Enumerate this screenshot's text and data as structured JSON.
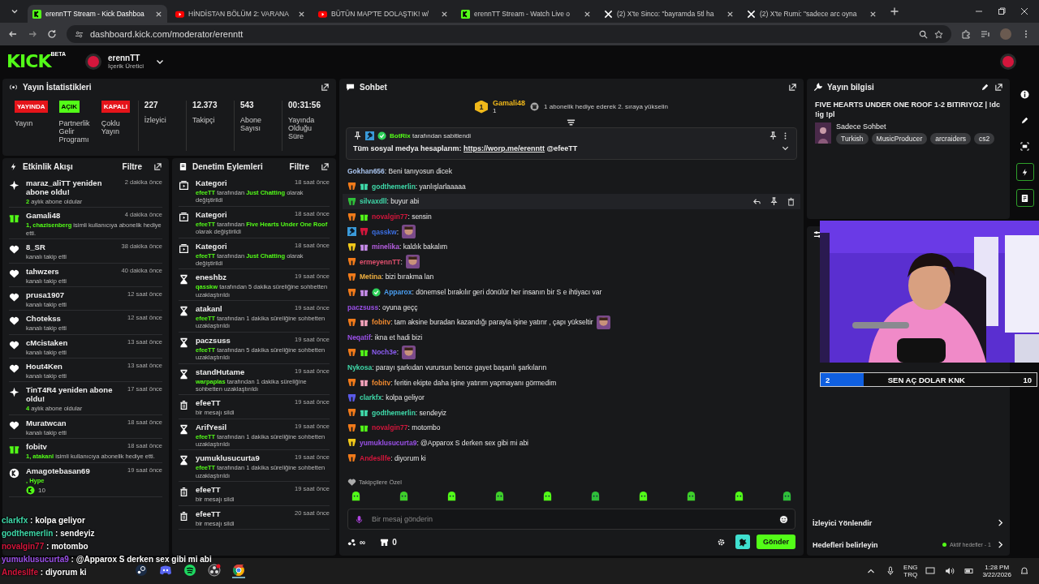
{
  "browser": {
    "tabs": [
      {
        "kind": "kick",
        "title": "erennTT Stream - Kick Dashboa",
        "selected": true
      },
      {
        "kind": "youtube",
        "title": "HİNDİSTAN BÖLÜM 2: VARANA",
        "selected": false
      },
      {
        "kind": "youtube",
        "title": "BÜTÜN MAP'TE DOLAŞTIK! w/",
        "selected": false
      },
      {
        "kind": "kick",
        "title": "erennTT Stream - Watch Live o",
        "selected": false
      },
      {
        "kind": "x",
        "title": "(2) X'te Sinco: \"bayramda 5tl ha",
        "selected": false
      },
      {
        "kind": "x",
        "title": "(2) X'te Rumi: \"sadece arc oyna",
        "selected": false
      }
    ],
    "url": "dashboard.kick.com/moderator/erenntt"
  },
  "header": {
    "logo": "KICK",
    "logo_tag": "BETA",
    "channel": "erennTT",
    "role": "İçerik Üretici"
  },
  "stats": {
    "title": "Yayın İstatistikleri",
    "items": [
      {
        "kind": "badge",
        "badge": "YAYINDA",
        "color": "#e5141a",
        "caption": "Yayın"
      },
      {
        "kind": "badge",
        "badge": "AÇIK",
        "color": "#53fc18",
        "caption": "Partnerlik Gelir Programı"
      },
      {
        "kind": "badge",
        "badge": "KAPALI",
        "color": "#e5141a",
        "caption": "Çoklu Yayın"
      },
      {
        "kind": "value",
        "value": "227",
        "caption": "İzleyici"
      },
      {
        "kind": "value",
        "value": "12.373",
        "caption": "Takipçi"
      },
      {
        "kind": "value",
        "value": "543",
        "caption": "Abone Sayısı"
      },
      {
        "kind": "value",
        "value": "00:31:56",
        "caption": "Yayında Olduğu Süre"
      }
    ]
  },
  "activity": {
    "title": "Etkinlik Akışı",
    "filter": "Filtre",
    "items": [
      {
        "kind": "resub",
        "title": "maraz_aliTT yeniden abone oldu!",
        "time": "2 dakika önce",
        "detail": [
          {
            "text": "2",
            "accent": true
          },
          {
            "text": " aylık abone oldular",
            "accent": false
          }
        ]
      },
      {
        "kind": "gift",
        "title": "Gamali48",
        "time": "4 dakika önce",
        "detail": [
          {
            "text": "1, chazisenberg",
            "accent": true
          },
          {
            "text": " isimli kullanıcıya abonelik hediye etti.",
            "accent": false
          }
        ]
      },
      {
        "kind": "follow",
        "title": "8_SR",
        "time": "38 dakika önce",
        "detail": [
          {
            "text": "kanalı takip etti",
            "accent": false
          }
        ]
      },
      {
        "kind": "follow",
        "title": "tahwzers",
        "time": "40 dakika önce",
        "detail": [
          {
            "text": "kanalı takip etti",
            "accent": false
          }
        ]
      },
      {
        "kind": "follow",
        "title": "prusa1907",
        "time": "12 saat önce",
        "detail": [
          {
            "text": "kanalı takip etti",
            "accent": false
          }
        ]
      },
      {
        "kind": "follow",
        "title": "Chotekss",
        "time": "12 saat önce",
        "detail": [
          {
            "text": "kanalı takip etti",
            "accent": false
          }
        ]
      },
      {
        "kind": "follow",
        "title": "cMcistaken",
        "time": "13 saat önce",
        "detail": [
          {
            "text": "kanalı takip etti",
            "accent": false
          }
        ]
      },
      {
        "kind": "follow",
        "title": "Hout4Ken",
        "time": "13 saat önce",
        "detail": [
          {
            "text": "kanalı takip etti",
            "accent": false
          }
        ]
      },
      {
        "kind": "resub",
        "title": "TinT4R4 yeniden abone oldu!",
        "time": "17 saat önce",
        "detail": [
          {
            "text": "4",
            "accent": true
          },
          {
            "text": " aylık abone oldular",
            "accent": false
          }
        ]
      },
      {
        "kind": "follow",
        "title": "Muratwcan",
        "time": "18 saat önce",
        "detail": [
          {
            "text": "kanalı takip etti",
            "accent": false
          }
        ]
      },
      {
        "kind": "gift",
        "title": "fobitv",
        "time": "18 saat önce",
        "detail": [
          {
            "text": "1, atakanl",
            "accent": true
          },
          {
            "text": " isimli kullanıcıya abonelik hediye etti.",
            "accent": false
          }
        ]
      },
      {
        "kind": "kicks",
        "title": "Amagotebasan69",
        "time": "19 saat önce",
        "detail": [
          {
            "text": ", Hype",
            "accent": true
          }
        ],
        "amount": "10"
      }
    ]
  },
  "moderation": {
    "title": "Denetim Eylemleri",
    "filter": "Filtre",
    "items": [
      {
        "kind": "category",
        "title": "Kategori",
        "time": "18 saat önce",
        "detail": [
          {
            "text": "efeeTT",
            "accent": true
          },
          {
            "text": " tarafından ",
            "accent": false
          },
          {
            "text": "Just Chatting",
            "accent": true
          },
          {
            "text": " olarak değiştirildi",
            "accent": false
          }
        ]
      },
      {
        "kind": "category",
        "title": "Kategori",
        "time": "18 saat önce",
        "detail": [
          {
            "text": "efeeTT",
            "accent": true
          },
          {
            "text": " tarafından ",
            "accent": false
          },
          {
            "text": "Five Hearts Under One Roof",
            "accent": true
          },
          {
            "text": " olarak değiştirildi",
            "accent": false
          }
        ]
      },
      {
        "kind": "category",
        "title": "Kategori",
        "time": "18 saat önce",
        "detail": [
          {
            "text": "efeeTT",
            "accent": true
          },
          {
            "text": " tarafından ",
            "accent": false
          },
          {
            "text": "Just Chatting",
            "accent": true
          },
          {
            "text": " olarak değiştirildi",
            "accent": false
          }
        ]
      },
      {
        "kind": "timeout",
        "title": "eneshbz",
        "time": "19 saat önce",
        "detail": [
          {
            "text": "qasskw",
            "accent": true
          },
          {
            "text": " tarafından 5 dakika süreliğine sohbetten uzaklaştırıldı",
            "accent": false
          }
        ]
      },
      {
        "kind": "timeout",
        "title": "atakanl",
        "time": "19 saat önce",
        "detail": [
          {
            "text": "efeeTT",
            "accent": true
          },
          {
            "text": " tarafından 1 dakika süreliğine sohbetten uzaklaştırıldı",
            "accent": false
          }
        ]
      },
      {
        "kind": "timeout",
        "title": "paczsuss",
        "time": "19 saat önce",
        "detail": [
          {
            "text": "efeeTT",
            "accent": true
          },
          {
            "text": " tarafından 5 dakika süreliğine sohbetten uzaklaştırıldı",
            "accent": false
          }
        ]
      },
      {
        "kind": "timeout",
        "title": "standHutame",
        "time": "19 saat önce",
        "detail": [
          {
            "text": "warpaplas",
            "accent": true
          },
          {
            "text": " tarafından 1 dakika süreliğine sohbetten uzaklaştırıldı",
            "accent": false
          }
        ]
      },
      {
        "kind": "delete",
        "title": "efeeTT",
        "time": "19 saat önce",
        "detail": [
          {
            "text": "bir mesajı sildi",
            "accent": false
          }
        ]
      },
      {
        "kind": "timeout",
        "title": "ArifYesil",
        "time": "19 saat önce",
        "detail": [
          {
            "text": "efeeTT",
            "accent": true
          },
          {
            "text": " tarafından 1 dakika süreliğine sohbetten uzaklaştırıldı",
            "accent": false
          }
        ]
      },
      {
        "kind": "timeout",
        "title": "yumuklusucurta9",
        "time": "19 saat önce",
        "detail": [
          {
            "text": "efeeTT",
            "accent": true
          },
          {
            "text": " tarafından 1 dakika süreliğine sohbetten uzaklaştırıldı",
            "accent": false
          }
        ]
      },
      {
        "kind": "delete",
        "title": "efeeTT",
        "time": "19 saat önce",
        "detail": [
          {
            "text": "bir mesajı sildi",
            "accent": false
          }
        ]
      },
      {
        "kind": "delete",
        "title": "efeeTT",
        "time": "20 saat önce",
        "detail": [
          {
            "text": "bir mesajı sildi",
            "accent": false
          }
        ]
      }
    ]
  },
  "chat": {
    "title": "Sohbet",
    "gifter": {
      "rank": "1",
      "name": "Gamali48",
      "count": "1",
      "prompt": "1 abonelik hediye ederek 2. sıraya yükselin"
    },
    "pinned": {
      "by": "BotRix",
      "by_suffix": " tarafından sabitlendi",
      "text": "Tüm sosyal medya hesaplarım: ",
      "link": "https://worp.me/erenntt",
      "after": " @efeeTT"
    },
    "messages": [
      {
        "user": "Gokhan656",
        "color": "#a9c4ee",
        "text": ": Beni tanıyosun dicek",
        "emote": false,
        "hovered": false
      },
      {
        "user": "godthemerlin",
        "color": "#3fd9a9",
        "badges": [
          {
            "kind": "sub",
            "color": "#f07a1a"
          },
          {
            "kind": "gift",
            "color": "#3fd9a9"
          }
        ],
        "text": ": yanlışlarlaaaaa",
        "emote": false,
        "hovered": false
      },
      {
        "user": "silvaxdll",
        "color": "#3fd9a9",
        "badges": [
          {
            "kind": "sub",
            "color": "#2fbf3a"
          }
        ],
        "text": ": buyur abi",
        "emote": false,
        "hovered": true
      },
      {
        "user": "novalgin77",
        "color": "#d4163c",
        "badges": [
          {
            "kind": "sub",
            "color": "#f07a1a"
          },
          {
            "kind": "gift",
            "color": "#53fc18"
          }
        ],
        "text": ": sensin",
        "emote": false,
        "hovered": false
      },
      {
        "user": "qasskw",
        "color": "#3b6ee0",
        "badges": [
          {
            "kind": "mod",
            "color": "#3a9ad9"
          },
          {
            "kind": "sub",
            "color": "#d4163c"
          }
        ],
        "text": ":",
        "emote": true,
        "hovered": false
      },
      {
        "user": "minelika",
        "color": "#b55ee0",
        "badges": [
          {
            "kind": "sub",
            "color": "#f0c81a"
          },
          {
            "kind": "gift",
            "color": "#c58ae8"
          }
        ],
        "text": ": kaldık bakalım",
        "emote": false,
        "hovered": false
      },
      {
        "user": "ermeyennTT",
        "color": "#e0506e",
        "badges": [
          {
            "kind": "sub",
            "color": "#f07a1a"
          }
        ],
        "text": ":",
        "emote": true,
        "hovered": false
      },
      {
        "user": "Metina",
        "color": "#f0b040",
        "badges": [
          {
            "kind": "sub",
            "color": "#f07a1a"
          }
        ],
        "text": ": bizi bırakma lan",
        "emote": false,
        "hovered": false
      },
      {
        "user": "Apparox",
        "color": "#4a9ef0",
        "badges": [
          {
            "kind": "sub",
            "color": "#f07a1a"
          },
          {
            "kind": "gift",
            "color": "#c58ae8"
          },
          {
            "kind": "verified",
            "color": "#2fd15a"
          }
        ],
        "text": ": dönemsel bırakılır geri dönülür her insanın bir S e ihtiyacı var",
        "emote": false,
        "hovered": false
      },
      {
        "user": "paczsuss",
        "color": "#9b50e8",
        "text": ": oyuna geçç",
        "emote": false,
        "hovered": false
      },
      {
        "user": "fobitv",
        "color": "#f08a30",
        "badges": [
          {
            "kind": "sub",
            "color": "#f07a1a"
          },
          {
            "kind": "gift",
            "color": "#f0a0b8"
          }
        ],
        "text": ": tam aksine buradan kazandığı parayla işine yatırır , çapı yükseltir",
        "emote": true,
        "hovered": false
      },
      {
        "user": "Neqatif",
        "color": "#9b50e8",
        "text": ": ikna et hadi bizi",
        "emote": false,
        "hovered": false
      },
      {
        "user": "Noch3e",
        "color": "#8a5cf0",
        "badges": [
          {
            "kind": "sub",
            "color": "#f07a1a"
          },
          {
            "kind": "gift",
            "color": "#53fc18"
          }
        ],
        "text": ":",
        "emote": true,
        "hovered": false
      },
      {
        "user": "Nykosa",
        "color": "#3fd9a9",
        "text": ": parayı şarkıdan vurursun bence gayet başarılı şarkıların",
        "emote": false,
        "hovered": false
      },
      {
        "user": "fobitv",
        "color": "#f08a30",
        "badges": [
          {
            "kind": "sub",
            "color": "#f07a1a"
          },
          {
            "kind": "gift",
            "color": "#f0a0b8"
          }
        ],
        "text": ": feritin ekipte daha işine yatırım yapmayanı görmedim",
        "emote": false,
        "hovered": false
      },
      {
        "user": "clarkfx",
        "color": "#3fd9a9",
        "badges": [
          {
            "kind": "sub",
            "color": "#5a5ae8"
          }
        ],
        "text": ": kolpa geliyor",
        "emote": false,
        "hovered": false
      },
      {
        "user": "godthemerlin",
        "color": "#3fd9a9",
        "badges": [
          {
            "kind": "sub",
            "color": "#f07a1a"
          },
          {
            "kind": "gift",
            "color": "#3fd9a9"
          }
        ],
        "text": ": sendeyiz",
        "emote": false,
        "hovered": false
      },
      {
        "user": "novalgin77",
        "color": "#d4163c",
        "badges": [
          {
            "kind": "sub",
            "color": "#f07a1a"
          },
          {
            "kind": "gift",
            "color": "#53fc18"
          }
        ],
        "text": ": motombo",
        "emote": false,
        "hovered": false
      },
      {
        "user": "yumuklusucurta9",
        "color": "#9b50e8",
        "badges": [
          {
            "kind": "sub",
            "color": "#f0c81a"
          }
        ],
        "text": ": @Apparox S derken sex gibi mi abi",
        "emote": false,
        "hovered": false
      },
      {
        "user": "Andesllfe",
        "color": "#d4163c",
        "badges": [
          {
            "kind": "sub",
            "color": "#f07a1a"
          }
        ],
        "text": ": diyorum ki",
        "emote": false,
        "hovered": false
      }
    ],
    "emote_label": "Takipçilere Özel",
    "placeholder": "Bir mesaj gönderin",
    "points": "∞",
    "store_count": "0",
    "send": "Gönder"
  },
  "stream_info": {
    "title": "Yayın bilgisi",
    "stream_title": "FIVE HEARTS UNDER ONE ROOF 1-2 BITIRIYOZ | !dc !ig !pl",
    "category": "Sadece Sohbet",
    "tags": [
      "Turkish",
      "MusicProducer",
      "arcraiders",
      "cs2"
    ]
  },
  "settings": {
    "items": [
      {
        "label": "İzleyici Yönlendir"
      },
      {
        "label": "Hedefleri belirleyin",
        "status": "Aktif hedefler - 1"
      }
    ]
  },
  "rail": [
    {
      "kind": "info",
      "active": false
    },
    {
      "kind": "pencil",
      "active": false
    },
    {
      "kind": "camera",
      "active": false
    },
    {
      "kind": "bolt",
      "active": true
    },
    {
      "kind": "note",
      "active": true
    }
  ],
  "goal": {
    "current": "2",
    "title": "SEN AÇ DOLAR KNK",
    "target": "10",
    "level": 0.2
  },
  "overlay_chat": [
    {
      "user": "clarkfx",
      "color": "#3fd9a9",
      "text": " : kolpa geliyor"
    },
    {
      "user": "godthemerlin",
      "color": "#3fd9a9",
      "text": " : sendeyiz"
    },
    {
      "user": "novalgin77",
      "color": "#d4163c",
      "text": " : motombo"
    },
    {
      "user": "yumuklusucurta9",
      "color": "#9b50e8",
      "text": " : @Apparox S derken sex gibi mi abi"
    },
    {
      "user": "Andesllfe",
      "color": "#d4163c",
      "text": " : diyorum ki"
    }
  ],
  "taskbar": {
    "lang": "ENG",
    "layout": "TRQ",
    "time": "1:28 PM",
    "date": "3/22/2026"
  }
}
